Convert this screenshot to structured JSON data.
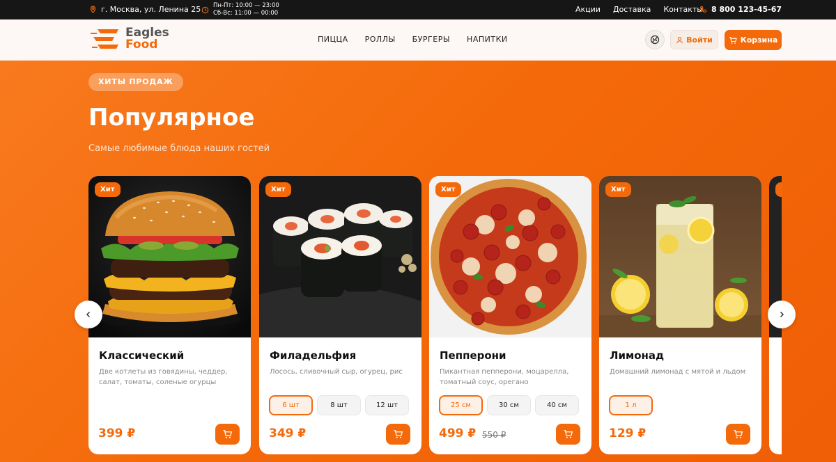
{
  "topbar": {
    "address": "г. Москва, ул. Ленина 25",
    "hours_weekdays": "Пн-Пт: 10:00 — 23:00",
    "hours_weekend": "Сб-Вс: 11:00 — 00:00",
    "links": [
      "Акции",
      "Доставка",
      "Контакты"
    ],
    "phone": "8 800 123-45-67"
  },
  "header": {
    "logo_line1": "Eagles",
    "logo_line2": "Food",
    "nav": [
      "ПИЦЦА",
      "РОЛЛЫ",
      "БУРГЕРЫ",
      "НАПИТКИ"
    ],
    "login_label": "Войти",
    "cart_label": "Корзина"
  },
  "hero": {
    "badge": "ХИТЫ ПРОДАЖ",
    "title": "Популярное",
    "subtitle": "Самые любимые блюда наших гостей"
  },
  "products": [
    {
      "badge": "Хит",
      "name": "Классический",
      "description": "Две котлеты из говядины, чеддер, салат, томаты, соленые огурцы",
      "sizes": [],
      "price": "399 ₽",
      "old_price": ""
    },
    {
      "badge": "Хит",
      "name": "Филадельфия",
      "description": "Лосось, сливочный сыр, огурец, рис",
      "sizes": [
        "6 шт",
        "8 шт",
        "12 шт"
      ],
      "price": "349 ₽",
      "old_price": ""
    },
    {
      "badge": "Хит",
      "name": "Пепперони",
      "description": "Пикантная пепперони, моцарелла, томатный соус, орегано",
      "sizes": [
        "25 см",
        "30 см",
        "40 см"
      ],
      "price": "499 ₽",
      "old_price": "550 ₽"
    },
    {
      "badge": "Хит",
      "name": "Лимонад",
      "description": "Домашний лимонад с мятой и льдом",
      "sizes": [
        "1 л"
      ],
      "price": "129 ₽",
      "old_price": ""
    }
  ],
  "colors": {
    "accent": "#f46a0a",
    "dark": "#161616"
  },
  "icons": [
    "location-icon",
    "clock-icon",
    "phone-icon",
    "accessibility-icon",
    "user-icon",
    "cart-icon",
    "chevron-left-icon",
    "chevron-right-icon"
  ]
}
